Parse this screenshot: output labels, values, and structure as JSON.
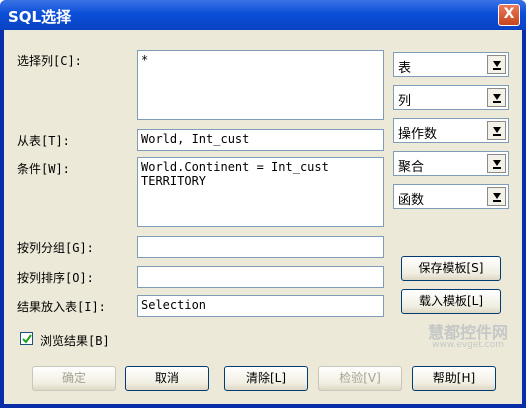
{
  "window": {
    "title": "SQL选择",
    "close": "X"
  },
  "labels": {
    "select_columns": "选择列[C]:",
    "from_table": "从表[T]:",
    "condition": "条件[W]:",
    "group_by": "按列分组[G]:",
    "order_by": "按列排序[O]:",
    "into_table": "结果放入表[I]:",
    "browse": "浏览结果[B]"
  },
  "fields": {
    "select_columns": "*",
    "from_table": "World, Int_cust",
    "condition": "World.Continent = Int_cust\nTERRITORY",
    "group_by": "",
    "order_by": "",
    "into_table": "Selection"
  },
  "combos": [
    "表",
    "列",
    "操作数",
    "聚合",
    "函数"
  ],
  "side_buttons": {
    "save_template": "保存模板[S]",
    "load_template": "载入模板[L]"
  },
  "buttons": {
    "ok": "确定",
    "cancel": "取消",
    "clear": "清除[L]",
    "verify": "检验[V]",
    "help": "帮助[H]"
  },
  "browse_checked": true,
  "watermark": {
    "main": "慧都控件网",
    "sub": "www.evget.com"
  }
}
